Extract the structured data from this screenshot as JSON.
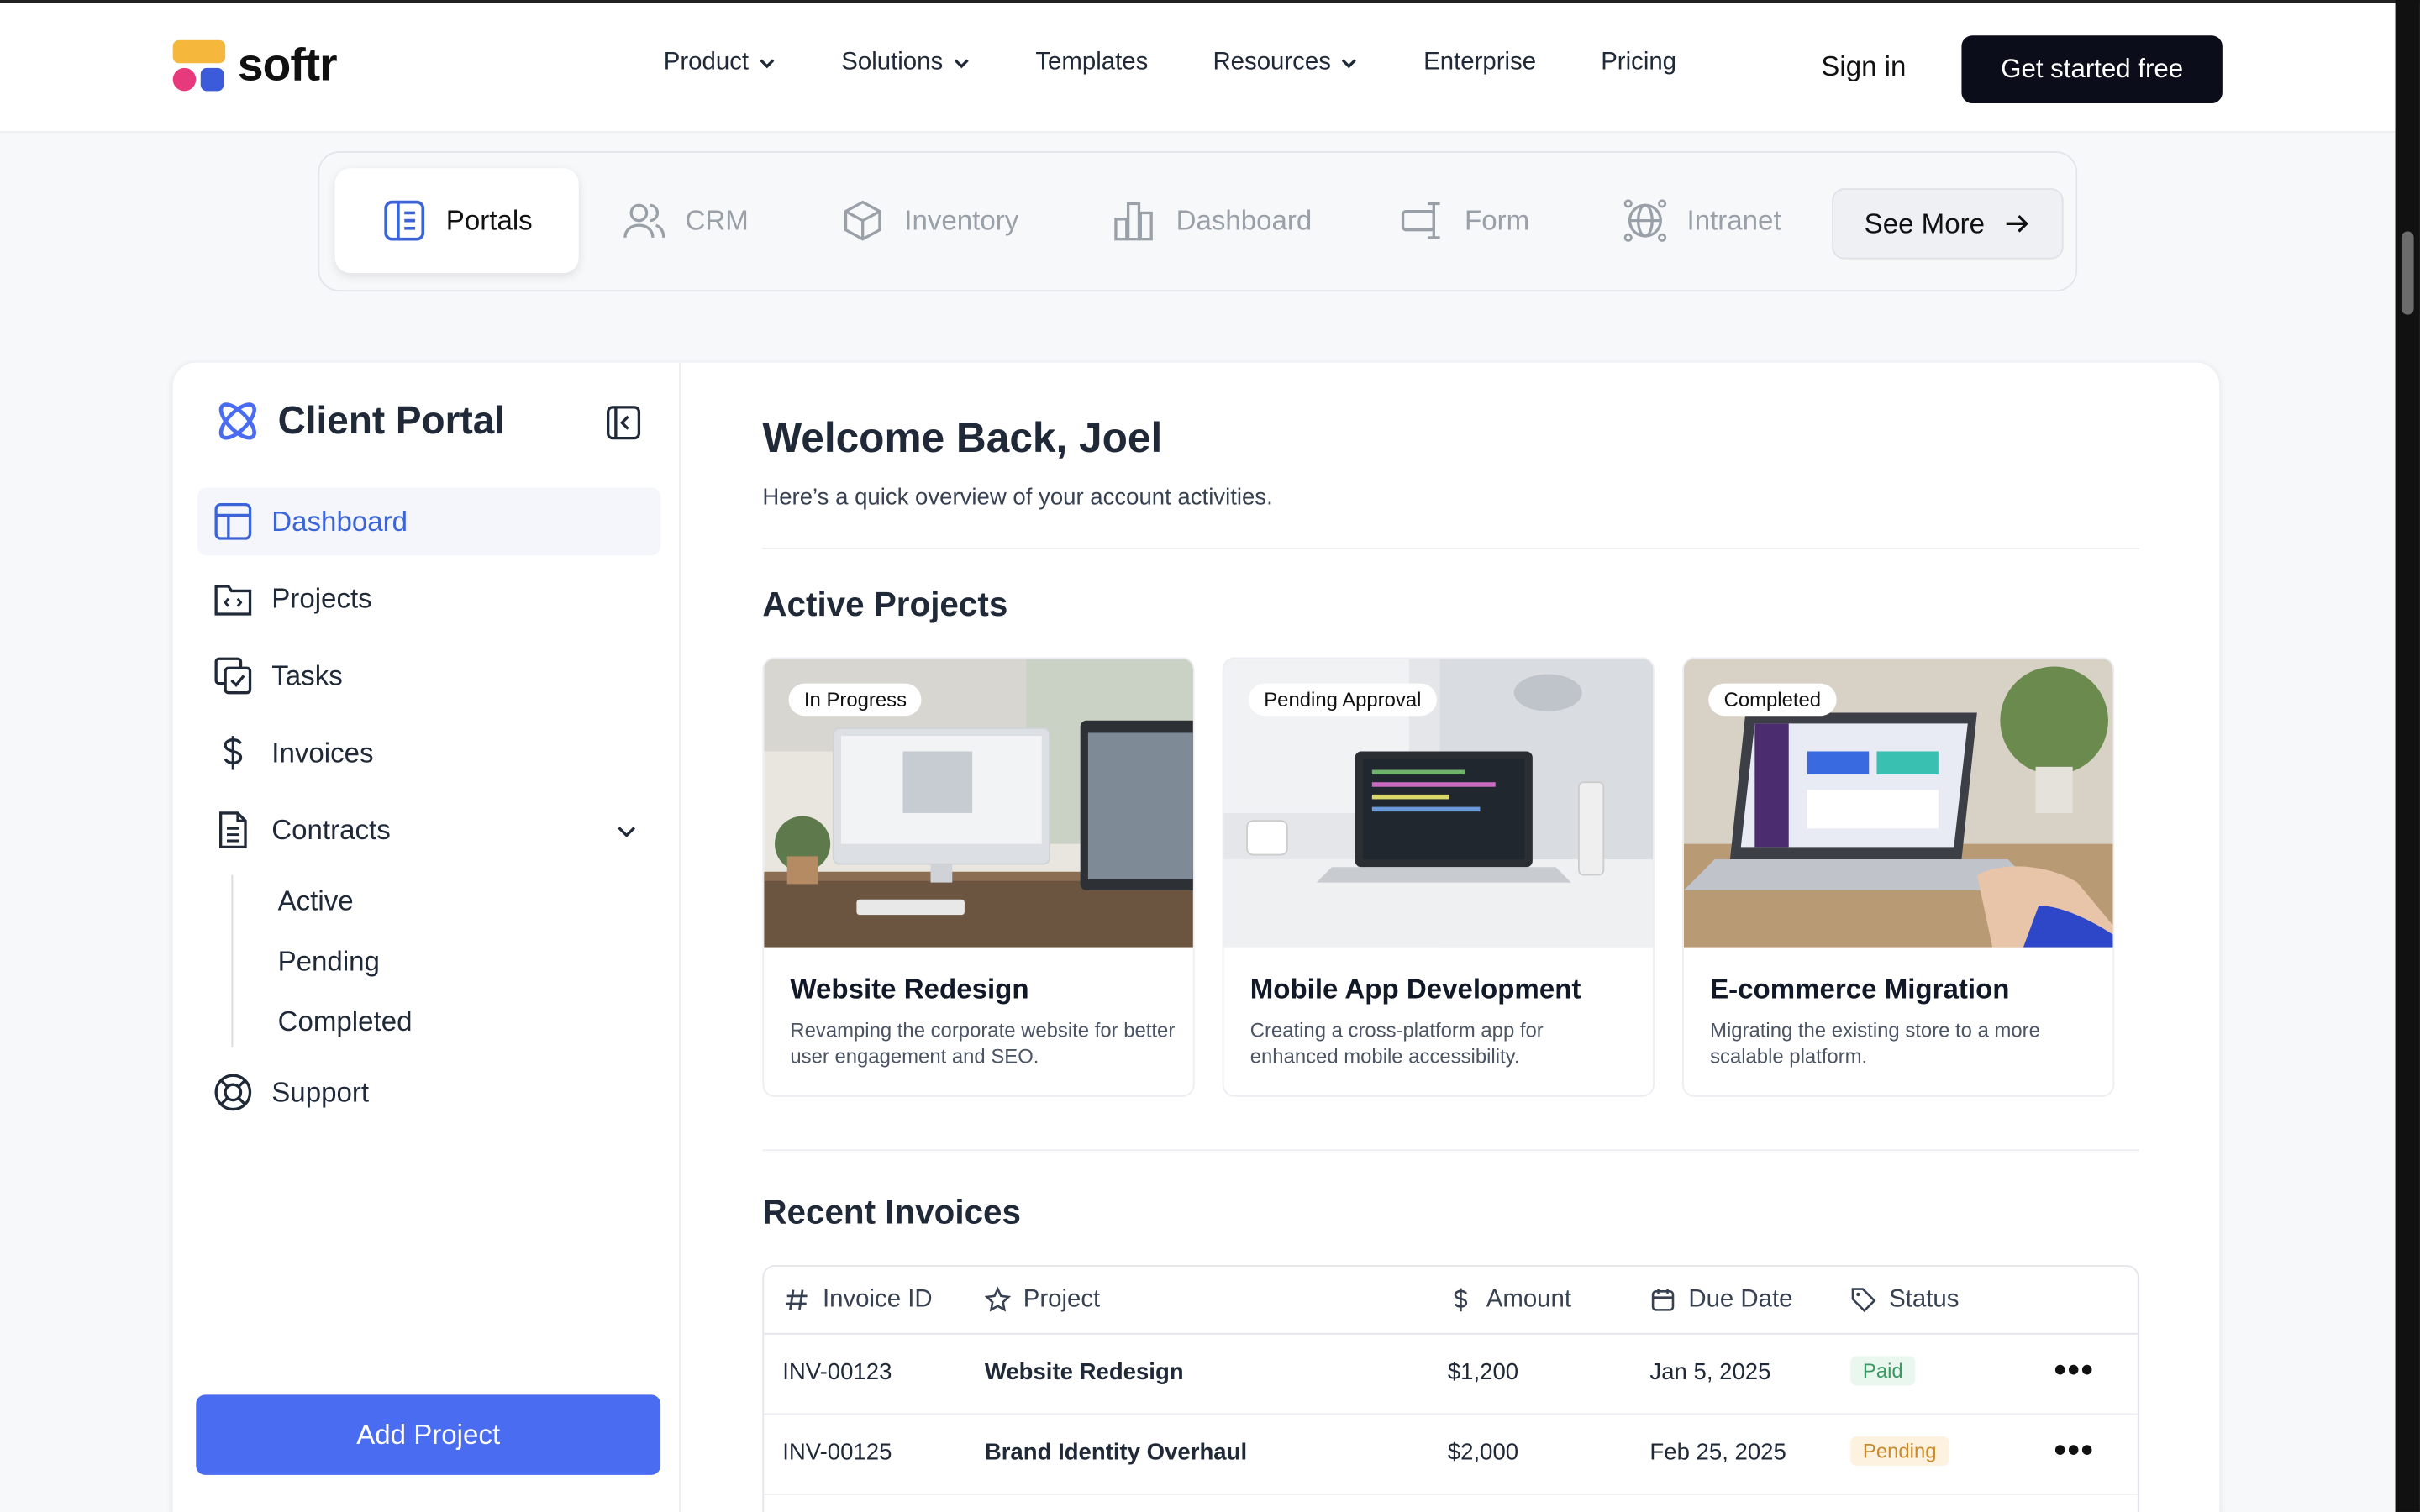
{
  "nav": {
    "logo": "softr",
    "menu": [
      {
        "label": "Product",
        "dropdown": true
      },
      {
        "label": "Solutions",
        "dropdown": true
      },
      {
        "label": "Templates",
        "dropdown": false
      },
      {
        "label": "Resources",
        "dropdown": true
      },
      {
        "label": "Enterprise",
        "dropdown": false
      },
      {
        "label": "Pricing",
        "dropdown": false
      }
    ],
    "signin": "Sign in",
    "cta": "Get started free"
  },
  "tabs": {
    "items": [
      "Portals",
      "CRM",
      "Inventory",
      "Dashboard",
      "Form",
      "Intranet"
    ],
    "active": "Portals",
    "see_more": "See More"
  },
  "sidebar": {
    "title": "Client Portal",
    "items": [
      "Dashboard",
      "Projects",
      "Tasks",
      "Invoices",
      "Contracts",
      "Support"
    ],
    "active": "Dashboard",
    "contracts_sub": [
      "Active",
      "Pending",
      "Completed"
    ],
    "add_button": "Add Project"
  },
  "main": {
    "welcome": "Welcome Back, Joel",
    "subtitle": "Here’s a quick overview of your account activities.",
    "active_projects_heading": "Active Projects",
    "projects": [
      {
        "badge": "In Progress",
        "title": "Website Redesign",
        "desc": "Revamping the corporate website for better user engagement and SEO."
      },
      {
        "badge": "Pending Approval",
        "title": "Mobile App Development",
        "desc": "Creating a cross-platform app for enhanced mobile accessibility."
      },
      {
        "badge": "Completed",
        "title": "E-commerce Migration",
        "desc": "Migrating the existing store to a more scalable platform."
      }
    ],
    "invoices_heading": "Recent Invoices",
    "invoice_columns": [
      "Invoice ID",
      "Project",
      "Amount",
      "Due Date",
      "Status"
    ],
    "invoices": [
      {
        "id": "INV-00123",
        "project": "Website Redesign",
        "amount": "$1,200",
        "due": "Jan 5, 2025",
        "status": "Paid",
        "more": "•••"
      },
      {
        "id": "INV-00125",
        "project": "Brand Identity Overhaul",
        "amount": "$2,000",
        "due": "Feb 25, 2025",
        "status": "Pending",
        "more": "•••"
      }
    ]
  },
  "colors": {
    "accent": "#4a6cf0",
    "active_nav": "#3b64d8",
    "cta_bg": "#0b0e1a",
    "paid": "#3b9a63",
    "pending": "#c88a2a"
  }
}
